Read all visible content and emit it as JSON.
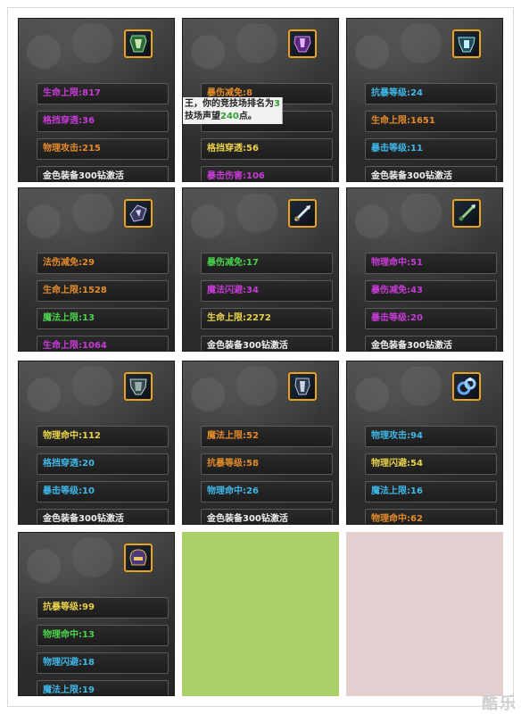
{
  "tooltip": {
    "line1_prefix": "王，你的竞技场排名为",
    "line1_rank": "3",
    "line2_prefix": "技场声望",
    "line2_value": "240",
    "line2_suffix": "点。",
    "partial_hidden_row": "暴伤减免:8"
  },
  "cards": [
    {
      "icon": "armor-green-icon",
      "rows": [
        {
          "text": "生命上限:817",
          "color": "purple"
        },
        {
          "text": "格挡穿透:36",
          "color": "purple"
        },
        {
          "text": "物理攻击:215",
          "color": "orange"
        },
        {
          "text": "金色装备300钻激活",
          "color": "white"
        }
      ]
    },
    {
      "icon": "armor-purple-icon",
      "rows": [
        {
          "text": "暴伤减免:86",
          "color": "purple"
        },
        {
          "text": "格挡穿透:56",
          "color": "yellow"
        },
        {
          "text": "暴击伤害:106",
          "color": "purple"
        }
      ]
    },
    {
      "icon": "armor-cyan-icon",
      "rows": [
        {
          "text": "抗暴等级:24",
          "color": "blue"
        },
        {
          "text": "生命上限:1651",
          "color": "orange"
        },
        {
          "text": "暴击等级:11",
          "color": "blue"
        },
        {
          "text": "金色装备300钻激活",
          "color": "white"
        }
      ]
    },
    {
      "icon": "shoulder-icon",
      "rows": [
        {
          "text": "法伤减免:29",
          "color": "orange"
        },
        {
          "text": "生命上限:1528",
          "color": "orange"
        },
        {
          "text": "魔法上限:13",
          "color": "green"
        },
        {
          "text": "生命上限:1064",
          "color": "purple"
        }
      ]
    },
    {
      "icon": "sword-icon",
      "rows": [
        {
          "text": "暴伤减免:17",
          "color": "green"
        },
        {
          "text": "魔法闪避:34",
          "color": "purple"
        },
        {
          "text": "生命上限:2272",
          "color": "yellow"
        },
        {
          "text": "金色装备300钻激活",
          "color": "white"
        }
      ]
    },
    {
      "icon": "dagger-icon",
      "rows": [
        {
          "text": "物理命中:51",
          "color": "purple"
        },
        {
          "text": "暴伤减免:43",
          "color": "purple"
        },
        {
          "text": "暴击等级:20",
          "color": "purple"
        },
        {
          "text": "金色装备300钻激活",
          "color": "white"
        }
      ]
    },
    {
      "icon": "chest-armor-icon",
      "rows": [
        {
          "text": "物理命中:112",
          "color": "yellow"
        },
        {
          "text": "格挡穿透:20",
          "color": "blue"
        },
        {
          "text": "暴击等级:10",
          "color": "blue"
        },
        {
          "text": "金色装备300钻激活",
          "color": "white"
        }
      ]
    },
    {
      "icon": "leg-armor-icon",
      "rows": [
        {
          "text": "魔法上限:52",
          "color": "orange"
        },
        {
          "text": "抗暴等级:58",
          "color": "orange"
        },
        {
          "text": "物理命中:26",
          "color": "blue"
        },
        {
          "text": "金色装备300钻激活",
          "color": "white"
        }
      ]
    },
    {
      "icon": "ring-icon",
      "rows": [
        {
          "text": "物理攻击:94",
          "color": "blue"
        },
        {
          "text": "物理闪避:54",
          "color": "yellow"
        },
        {
          "text": "魔法上限:16",
          "color": "blue"
        },
        {
          "text": "物理命中:62",
          "color": "orange"
        }
      ]
    },
    {
      "icon": "helmet-icon",
      "rows": [
        {
          "text": "抗暴等级:99",
          "color": "yellow"
        },
        {
          "text": "物理命中:13",
          "color": "green"
        },
        {
          "text": "物理闪避:18",
          "color": "blue"
        },
        {
          "text": "魔法上限:19",
          "color": "blue"
        }
      ]
    }
  ],
  "swatches": [
    "#a8cf6a",
    "#e2cfcf"
  ],
  "watermark": "酷乐"
}
